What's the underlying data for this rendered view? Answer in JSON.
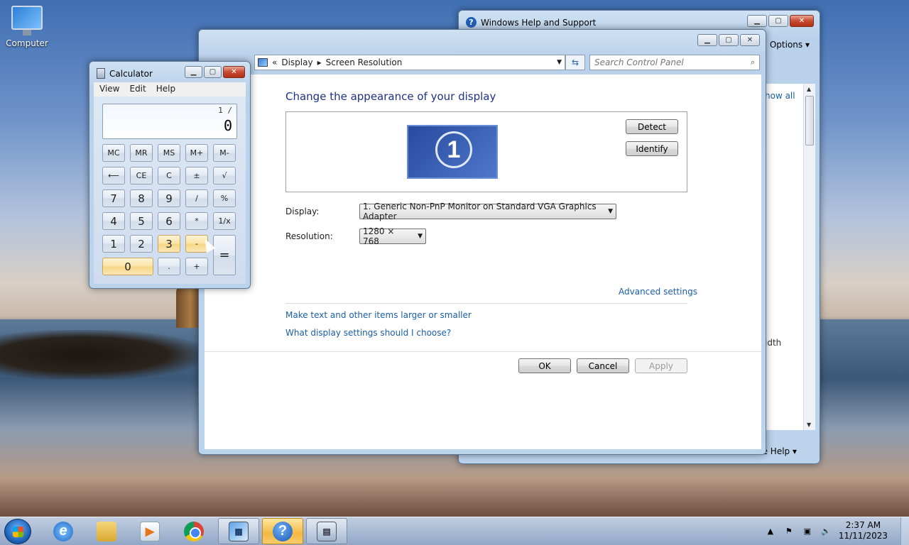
{
  "desktop": {
    "icon_label": "Computer"
  },
  "help_window": {
    "title": "Windows Help and Support",
    "options": "Options ▾",
    "show_all": "how all",
    "width_fragment": "idth",
    "footer": "e Help ▾"
  },
  "control_panel": {
    "breadcrumb": {
      "root": "«",
      "item1": "Display",
      "item2": "Screen Resolution"
    },
    "search_placeholder": "Search Control Panel",
    "heading": "Change the appearance of your display",
    "monitor_number": "1",
    "detect": "Detect",
    "identify": "Identify",
    "display_label": "Display:",
    "display_value": "1. Generic Non-PnP Monitor on Standard VGA Graphics Adapter",
    "resolution_label": "Resolution:",
    "resolution_value": "1280 × 768",
    "advanced_settings": "Advanced settings",
    "link_text_size": "Make text and other items larger or smaller",
    "link_what_settings": "What display settings should I choose?",
    "ok": "OK",
    "cancel": "Cancel",
    "apply": "Apply"
  },
  "calculator": {
    "title": "Calculator",
    "menu": [
      "View",
      "Edit",
      "Help"
    ],
    "expression": "1 /",
    "value": "0",
    "keys": {
      "mc": "MC",
      "mr": "MR",
      "ms": "MS",
      "mplus": "M+",
      "mminus": "M-",
      "back": "⟵",
      "ce": "CE",
      "c": "C",
      "pm": "±",
      "sqrt": "√",
      "k7": "7",
      "k8": "8",
      "k9": "9",
      "div": "/",
      "pct": "%",
      "k4": "4",
      "k5": "5",
      "k6": "6",
      "mul": "*",
      "inv": "1/x",
      "k1": "1",
      "k2": "2",
      "k3": "3",
      "sub": "-",
      "eq": "=",
      "k0": "0",
      "dot": ".",
      "add": "+"
    }
  },
  "taskbar": {
    "clock_time": "2:37 AM",
    "clock_date": "11/11/2023"
  }
}
